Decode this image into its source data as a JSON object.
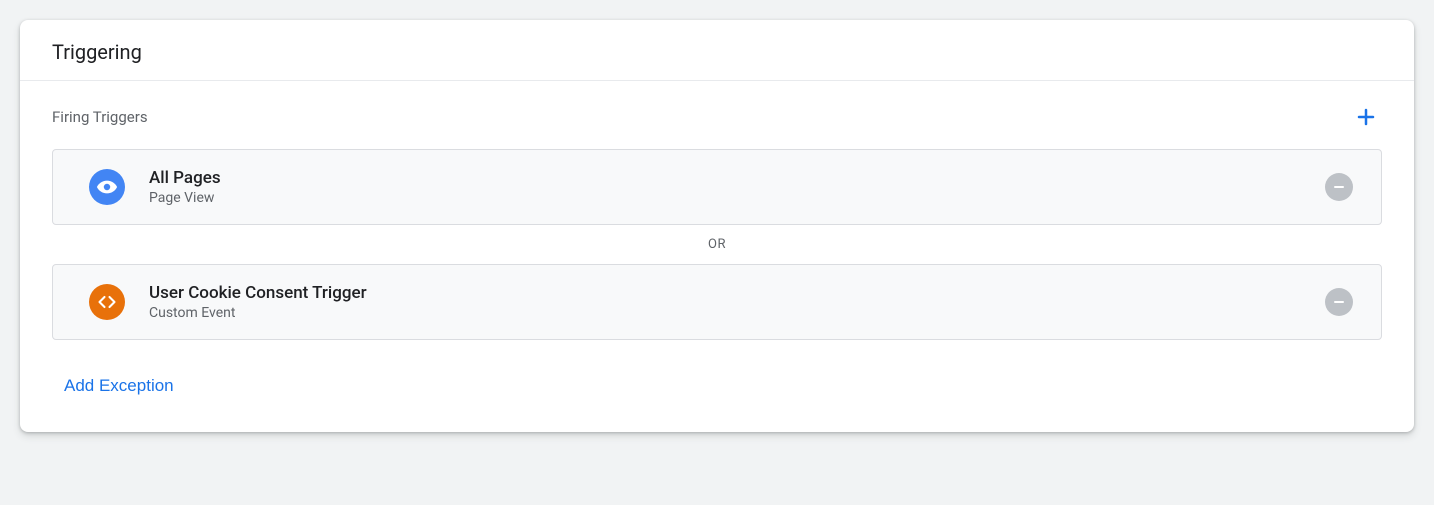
{
  "header": {
    "title": "Triggering"
  },
  "firing": {
    "label": "Firing Triggers",
    "separator": "OR",
    "triggers": [
      {
        "name": "All Pages",
        "type": "Page View"
      },
      {
        "name": "User Cookie Consent Trigger",
        "type": "Custom Event"
      }
    ]
  },
  "actions": {
    "add_exception": "Add Exception"
  }
}
